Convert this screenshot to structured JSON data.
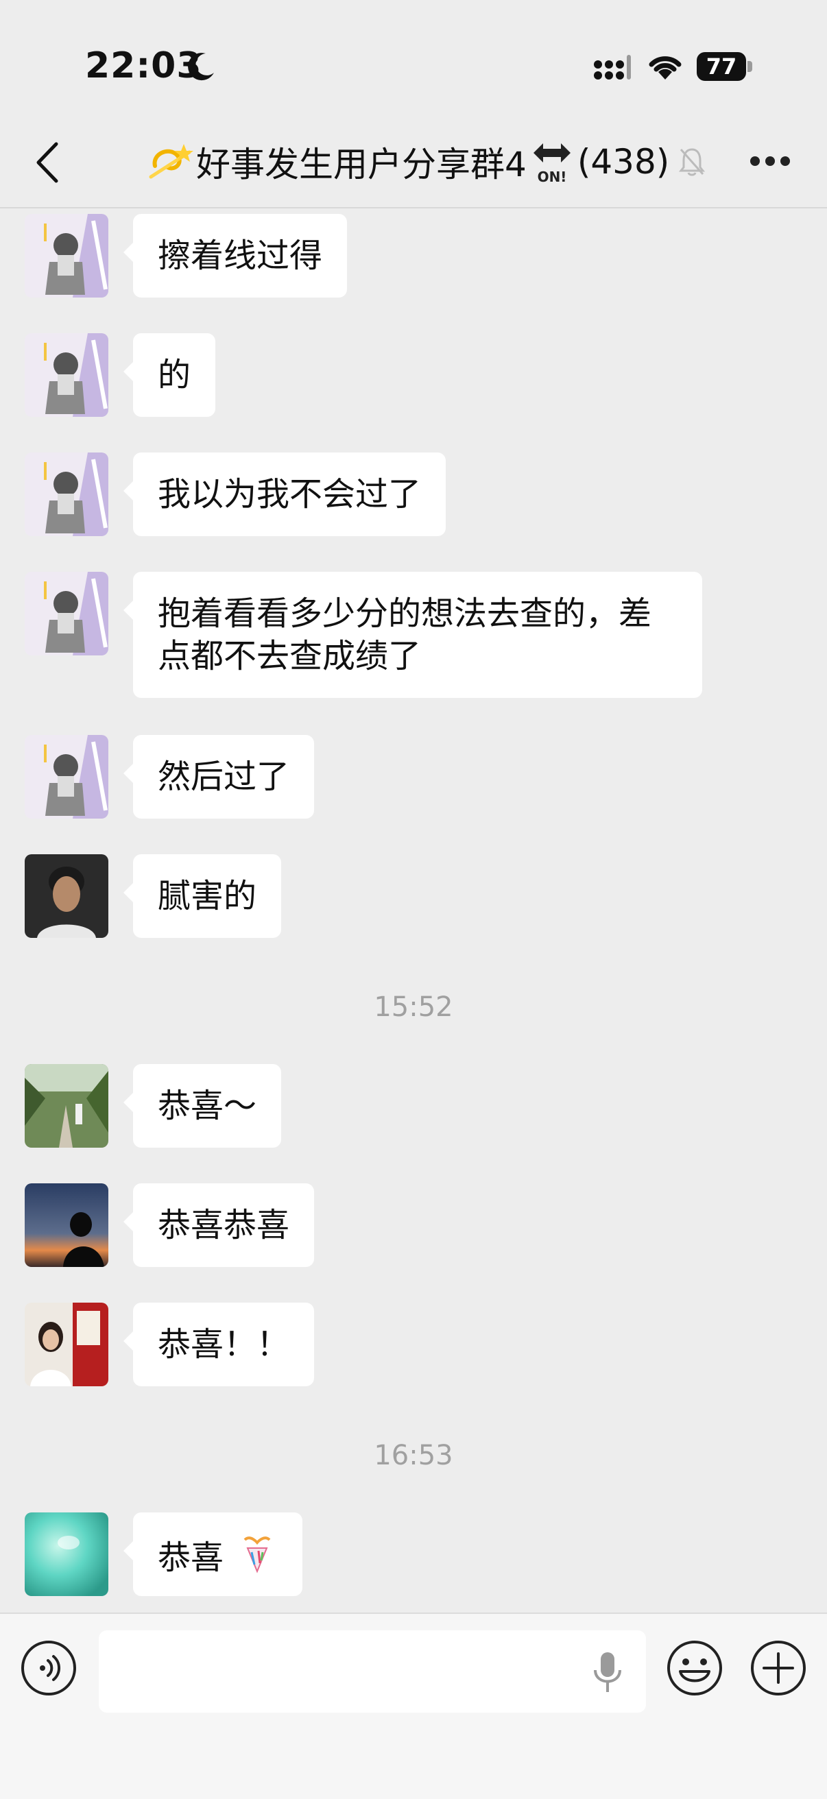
{
  "status_bar": {
    "time": "22:03",
    "battery": "77",
    "icons": [
      "moon-icon",
      "signal-icon",
      "wifi-icon",
      "battery-icon"
    ]
  },
  "nav": {
    "title": "好事发生用户分享群4",
    "count": "(438)",
    "title_emoji": "dizzy-icon",
    "badge_icon": "on-arrow-icon",
    "muted_icon": "bell-muted-icon"
  },
  "messages": [
    {
      "text": "擦着线过得",
      "avatar": "avatar-anime-girl"
    },
    {
      "text": "的",
      "avatar": "avatar-anime-girl"
    },
    {
      "text": "我以为我不会过了",
      "avatar": "avatar-anime-girl"
    },
    {
      "text": "抱着看看多少分的想法去查的，差",
      "text2": "点都不去查成绩了",
      "avatar": "avatar-anime-girl"
    },
    {
      "text": "然后过了",
      "avatar": "avatar-anime-girl"
    },
    {
      "text": "腻害的",
      "avatar": "avatar-man-portrait"
    }
  ],
  "timestamp1": "15:52",
  "messages2": [
    {
      "text": "恭喜～",
      "avatar": "avatar-garden-path"
    },
    {
      "text": "恭喜恭喜",
      "avatar": "avatar-sunset-silhouette"
    },
    {
      "text": "恭喜！！",
      "avatar": "avatar-woman-red-wall"
    }
  ],
  "timestamp2": "16:53",
  "messages3": [
    {
      "text": "恭喜",
      "emoji": "party-popper-icon",
      "avatar": "avatar-teal-abstract"
    }
  ],
  "colors": {
    "background": "#ededed",
    "bubble": "#ffffff",
    "timestamp": "#a0a0a0"
  }
}
